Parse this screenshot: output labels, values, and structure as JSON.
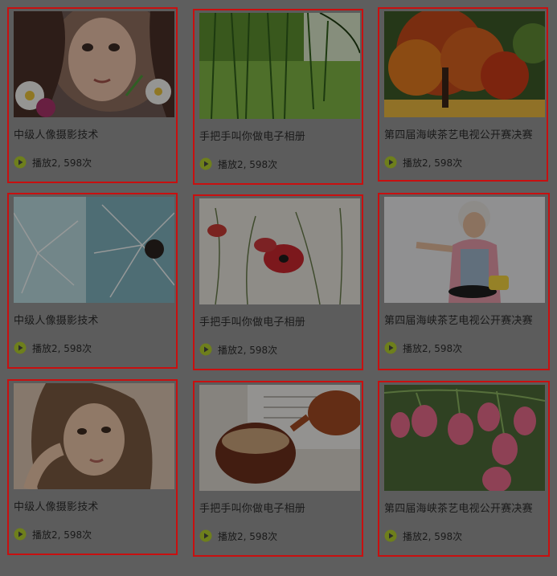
{
  "videos": [
    {
      "title": "中级人像摄影技术",
      "plays": "播放2, 598次",
      "image": "girl-with-flowers-photo"
    },
    {
      "title": "手把手叫你做电子相册",
      "plays": "播放2, 598次",
      "image": "willow-branches-photo"
    },
    {
      "title": "第四届海峡茶艺电视公开赛决赛",
      "plays": "播放2, 598次",
      "image": "autumn-tree-photo"
    },
    {
      "title": "中级人像摄影技术",
      "plays": "播放2, 598次",
      "image": "dandelion-photo"
    },
    {
      "title": "手把手叫你做电子相册",
      "plays": "播放2, 598次",
      "image": "red-poppies-photo"
    },
    {
      "title": "第四届海峡茶艺电视公开赛决赛",
      "plays": "播放2, 598次",
      "image": "grandma-cooking-photo"
    },
    {
      "title": "中级人像摄影技术",
      "plays": "播放2, 598次",
      "image": "woman-portrait-photo"
    },
    {
      "title": "手把手叫你做电子相册",
      "plays": "播放2, 598次",
      "image": "tea-cup-teapot-photo"
    },
    {
      "title": "第四届海峡茶艺电视公开赛决赛",
      "plays": "播放2, 598次",
      "image": "pink-bell-flowers-photo"
    }
  ],
  "colors": {
    "highlight_border": "#c81010",
    "play_icon": "#8aa321"
  }
}
